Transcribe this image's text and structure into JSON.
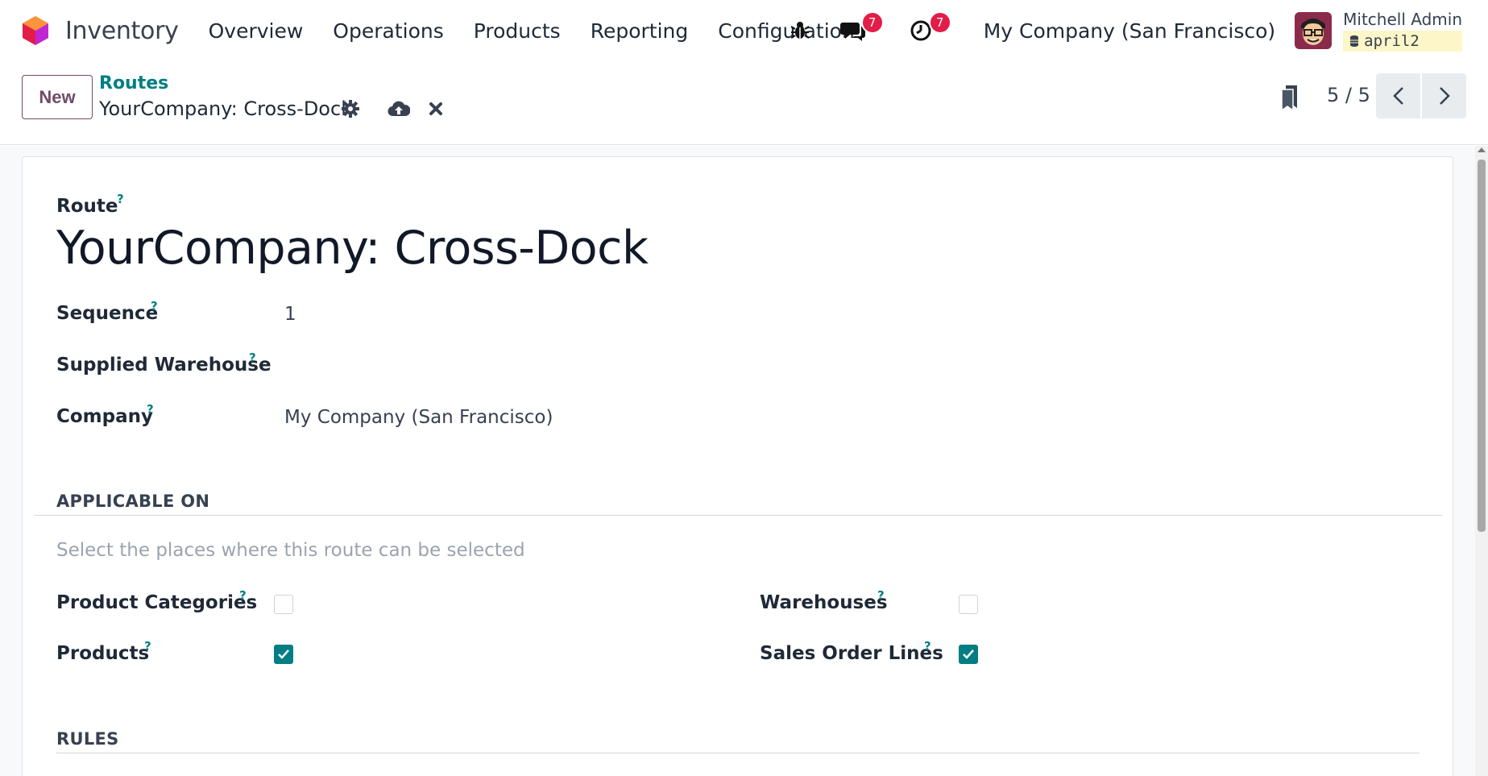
{
  "navbar": {
    "app_name": "Inventory",
    "menu": [
      "Overview",
      "Operations",
      "Products",
      "Reporting",
      "Configuration"
    ],
    "messages_badge": "7",
    "activities_badge": "7",
    "company": "My Company (San Francisco)",
    "user_name": "Mitchell Admin",
    "database": "april2"
  },
  "control_panel": {
    "new_button": "New",
    "breadcrumb_parent": "Routes",
    "breadcrumb_current": "YourCompany: Cross-Dock",
    "pager": "5 / 5"
  },
  "form": {
    "route_label": "Route",
    "route_name": "YourCompany: Cross-Dock",
    "sequence_label": "Sequence",
    "sequence_value": "1",
    "supplied_warehouse_label": "Supplied Warehouse",
    "supplied_warehouse_value": "",
    "company_label": "Company",
    "company_value": "My Company (San Francisco)",
    "help_mark": "?",
    "applicable_on": {
      "title": "APPLICABLE ON",
      "hint": "Select the places where this route can be selected",
      "product_categories_label": "Product Categories",
      "product_categories_checked": false,
      "products_label": "Products",
      "products_checked": true,
      "warehouses_label": "Warehouses",
      "warehouses_checked": false,
      "sales_order_lines_label": "Sales Order Lines",
      "sales_order_lines_checked": true
    },
    "rules_title": "RULES"
  },
  "colors": {
    "brand_purple": "#714b67",
    "teal": "#017e84",
    "badge_red": "#e11d48"
  }
}
